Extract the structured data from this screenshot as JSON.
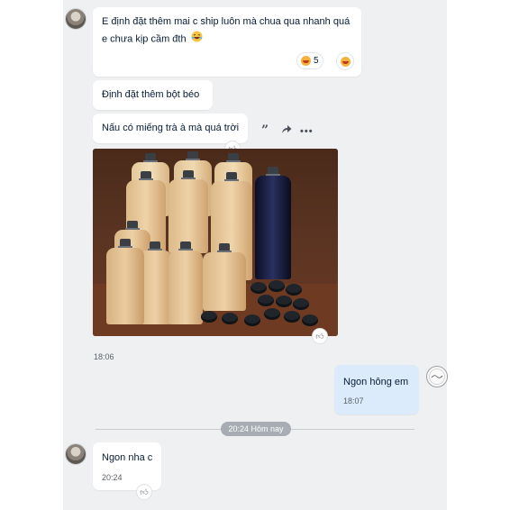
{
  "messages": {
    "m1": {
      "text_line1": "E định đặt thêm mai c ship luôn mà chua qua nhanh quá",
      "text_line2": "e chưa kịp cầm đth",
      "reaction_count": "5"
    },
    "m2": {
      "text": "Định đặt thêm bột béo"
    },
    "m3": {
      "text": "Nấu có miếng trà à mà quá trời"
    },
    "photo": {
      "time": "18:06"
    },
    "reply": {
      "text": "Ngon hông em",
      "time": "18:07"
    },
    "m5": {
      "text": "Ngon nha c",
      "time": "20:24"
    }
  },
  "divider": {
    "label": "20:24 Hôm nay"
  },
  "icons": {
    "quote": "quote-icon",
    "share": "share-icon",
    "more": "more-icon",
    "like": "thumbs-up-icon",
    "laugh": "laughing-emoji-icon"
  },
  "colors": {
    "chat_background": "#eef0f1",
    "bubble_received": "#ffffff",
    "bubble_sent": "#dbebfb",
    "date_pill": "#a8adb3"
  }
}
